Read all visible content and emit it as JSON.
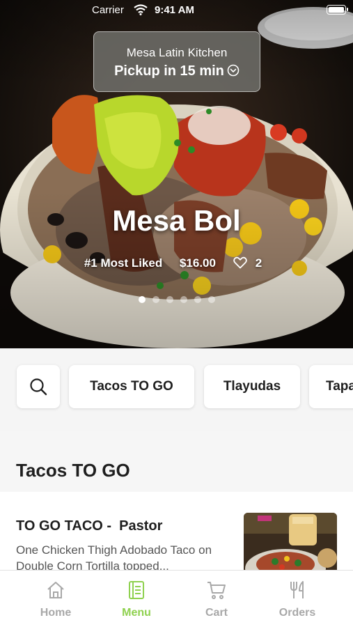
{
  "status_bar": {
    "carrier": "Carrier",
    "time": "9:41 AM"
  },
  "pickup": {
    "restaurant": "Mesa Latin Kitchen",
    "pickup_text": "Pickup in 15 min"
  },
  "featured": {
    "title": "Mesa Bol",
    "badge": "#1 Most Liked",
    "price": "$16.00",
    "likes": "2",
    "slides": 6,
    "active_slide": 1
  },
  "categories": [
    "Tacos TO GO",
    "Tlayudas",
    "Tapas"
  ],
  "section": {
    "title": "Tacos TO GO"
  },
  "menu_items": [
    {
      "name": "TO GO TACO -  Pastor",
      "description": "One Chicken Thigh Adobado Taco on Double Corn Tortilla topped..."
    }
  ],
  "tabs": [
    {
      "label": "Home",
      "icon": "home-icon"
    },
    {
      "label": "Menu",
      "icon": "menu-icon",
      "active": true
    },
    {
      "label": "Cart",
      "icon": "cart-icon"
    },
    {
      "label": "Orders",
      "icon": "fork-knife-icon"
    }
  ],
  "colors": {
    "accent": "#8fd14f",
    "inactive": "#a8a8a8"
  }
}
